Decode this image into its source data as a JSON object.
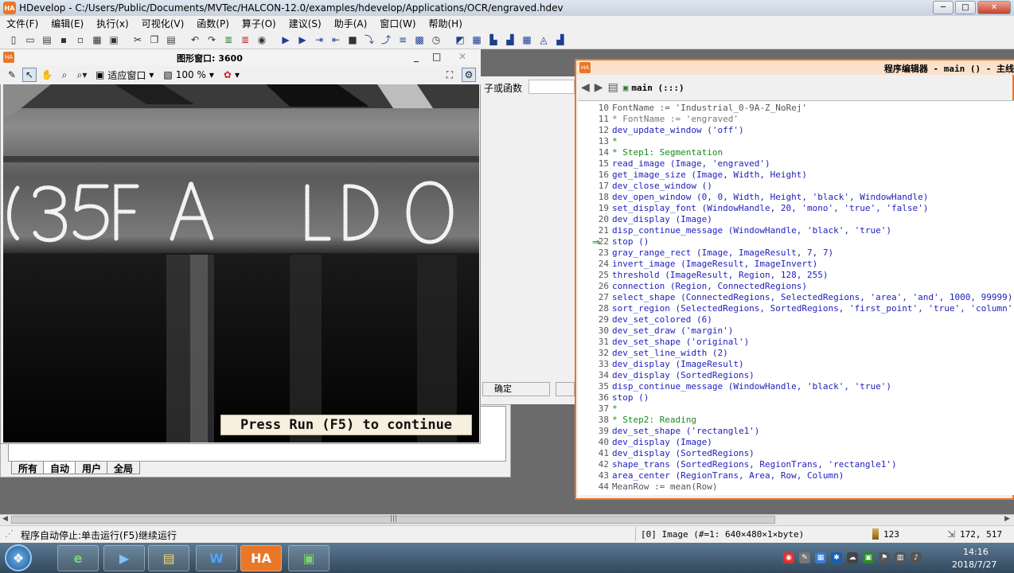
{
  "window": {
    "app_icon": "HA",
    "title": "HDevelop - C:/Users/Public/Documents/MVTec/HALCON-12.0/examples/hdevelop/Applications/OCR/engraved.hdev",
    "min": "─",
    "max": "□",
    "close": "✕"
  },
  "menu": [
    "文件(F)",
    "编辑(E)",
    "执行(x)",
    "可视化(V)",
    "函数(P)",
    "算子(O)",
    "建议(S)",
    "助手(A)",
    "窗口(W)",
    "帮助(H)"
  ],
  "graphics_window": {
    "icon": "HA",
    "title": "图形窗口: 3600",
    "fit_label": "适应窗口",
    "zoom_label": "100 %",
    "overlay_message": "Press Run (F5) to continue",
    "min": "_",
    "max": "□",
    "close": "✕"
  },
  "operator_window": {
    "label": "子或函数",
    "ok_label": "确定"
  },
  "variable_window": {
    "tabs": [
      "所有",
      "自动",
      "用户",
      "全局"
    ],
    "active_tab": 1
  },
  "program_editor": {
    "icon": "HA",
    "title": "程序编辑器 - main () - 主线",
    "procedure": "main (:::)",
    "pc_marker": "⇒",
    "lines": [
      {
        "n": "10",
        "t": "FontName := 'Industrial_0-9A-Z_NoRej'",
        "c": "pl"
      },
      {
        "n": "11",
        "t": "* FontName := 'engraved'",
        "c": "gr"
      },
      {
        "n": "12",
        "t": "dev_update_window ('off')",
        "c": "op"
      },
      {
        "n": "13",
        "t": "*",
        "c": "cm"
      },
      {
        "n": "14",
        "t": "* Step1: Segmentation",
        "c": "cm"
      },
      {
        "n": "15",
        "t": "read_image (Image, 'engraved')",
        "c": "op"
      },
      {
        "n": "16",
        "t": "get_image_size (Image, Width, Height)",
        "c": "op"
      },
      {
        "n": "17",
        "t": "dev_close_window ()",
        "c": "op"
      },
      {
        "n": "18",
        "t": "dev_open_window (0, 0, Width, Height, 'black', WindowHandle)",
        "c": "op"
      },
      {
        "n": "19",
        "t": "set_display_font (WindowHandle, 20, 'mono', 'true', 'false')",
        "c": "op"
      },
      {
        "n": "20",
        "t": "dev_display (Image)",
        "c": "op"
      },
      {
        "n": "21",
        "t": "disp_continue_message (WindowHandle, 'black', 'true')",
        "c": "op"
      },
      {
        "n": "22",
        "t": "stop ()",
        "c": "op"
      },
      {
        "n": "23",
        "t": "gray_range_rect (Image, ImageResult, 7, 7)",
        "c": "op"
      },
      {
        "n": "24",
        "t": "invert_image (ImageResult, ImageInvert)",
        "c": "op"
      },
      {
        "n": "25",
        "t": "threshold (ImageResult, Region, 128, 255)",
        "c": "op"
      },
      {
        "n": "26",
        "t": "connection (Region, ConnectedRegions)",
        "c": "op"
      },
      {
        "n": "27",
        "t": "select_shape (ConnectedRegions, SelectedRegions, 'area', 'and', 1000, 99999)",
        "c": "op"
      },
      {
        "n": "28",
        "t": "sort_region (SelectedRegions, SortedRegions, 'first_point', 'true', 'column')",
        "c": "op"
      },
      {
        "n": "29",
        "t": "dev_set_colored (6)",
        "c": "op"
      },
      {
        "n": "30",
        "t": "dev_set_draw ('margin')",
        "c": "op"
      },
      {
        "n": "31",
        "t": "dev_set_shape ('original')",
        "c": "op"
      },
      {
        "n": "32",
        "t": "dev_set_line_width (2)",
        "c": "op"
      },
      {
        "n": "33",
        "t": "dev_display (ImageResult)",
        "c": "op"
      },
      {
        "n": "34",
        "t": "dev_display (SortedRegions)",
        "c": "op"
      },
      {
        "n": "35",
        "t": "disp_continue_message (WindowHandle, 'black', 'true')",
        "c": "op"
      },
      {
        "n": "36",
        "t": "stop ()",
        "c": "op"
      },
      {
        "n": "37",
        "t": "*",
        "c": "cm"
      },
      {
        "n": "38",
        "t": "* Step2: Reading",
        "c": "cm"
      },
      {
        "n": "39",
        "t": "dev_set_shape ('rectangle1')",
        "c": "op"
      },
      {
        "n": "40",
        "t": "dev_display (Image)",
        "c": "op"
      },
      {
        "n": "41",
        "t": "dev_display (SortedRegions)",
        "c": "op"
      },
      {
        "n": "42",
        "t": "shape_trans (SortedRegions, RegionTrans, 'rectangle1')",
        "c": "op"
      },
      {
        "n": "43",
        "t": "area_center (RegionTrans, Area, Row, Column)",
        "c": "op"
      },
      {
        "n": "44",
        "t": "MeanRow := mean(Row)",
        "c": "pl"
      }
    ]
  },
  "statusbar": {
    "message": "程序自动停止:单击运行(F5)继续运行",
    "image_info": "[0] Image (#=1: 640×480×1×byte)",
    "gray_value": "123",
    "coords": "172, 517"
  },
  "taskbar": {
    "start_icon": "windows-logo-icon",
    "apps": [
      "e",
      "▶",
      "▤",
      "W",
      "HA",
      "▣"
    ],
    "time": "14:16",
    "date": "2018/7/27"
  },
  "colors": {
    "accent": "#e8772a",
    "code_operator": "#1d1dbd",
    "code_comment": "#1a8a1a"
  }
}
